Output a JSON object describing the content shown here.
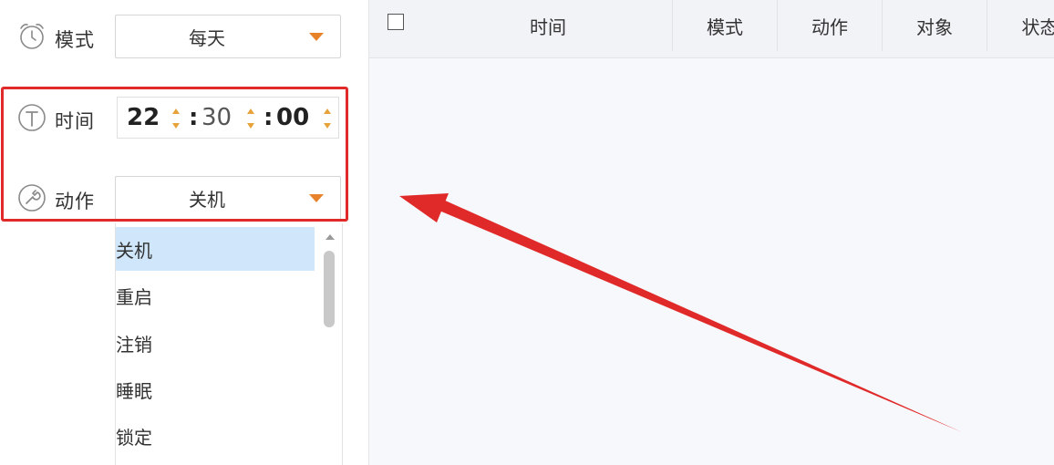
{
  "form": {
    "mode": {
      "label": "模式",
      "value": "每天"
    },
    "time": {
      "label": "时间",
      "hour": "22",
      "minute": "30",
      "second": "00",
      "sep": ":"
    },
    "action": {
      "label": "动作",
      "value": "关机"
    }
  },
  "action_options": [
    "关机",
    "重启",
    "注销",
    "睡眠",
    "锁定"
  ],
  "selected_option": "关机",
  "table": {
    "headers": [
      "时间",
      "模式",
      "动作",
      "对象",
      "状态"
    ]
  },
  "colors": {
    "highlight": "#e02a2a",
    "caret": "#e8822a",
    "selected_item": "#cfe6fb",
    "arrow": "#e02a2a"
  }
}
